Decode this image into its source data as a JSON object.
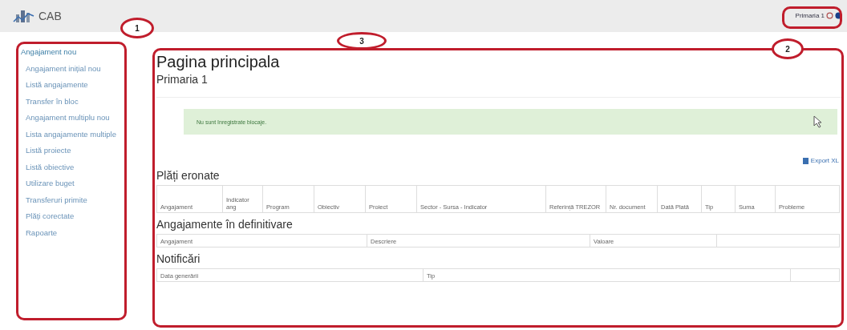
{
  "header": {
    "app_name": "CAB",
    "user": "Primaria 1"
  },
  "sidebar": {
    "items": [
      {
        "label": "Angajament nou",
        "selected": true
      },
      {
        "label": "Angajament inițial nou",
        "selected": false
      },
      {
        "label": "Listă angajamente",
        "selected": false
      },
      {
        "label": "Transfer în bloc",
        "selected": false
      },
      {
        "label": "Angajament multiplu nou",
        "selected": false
      },
      {
        "label": "Lista angajamente multiple",
        "selected": false
      },
      {
        "label": "Listă proiecte",
        "selected": false
      },
      {
        "label": "Listă obiective",
        "selected": false
      },
      {
        "label": "Utilizare buget",
        "selected": false
      },
      {
        "label": "Transferuri primite",
        "selected": false
      },
      {
        "label": "Plăți corectate",
        "selected": false
      },
      {
        "label": "Rapoarte",
        "selected": false
      }
    ]
  },
  "main": {
    "title": "Pagina principala",
    "subtitle": "Primaria 1",
    "alert": "Nu sunt înregistrate blocaje.",
    "export": "Export XL",
    "sections": [
      {
        "title": "Plăți eronate",
        "columns": [
          "Angajament",
          "Indicator ang",
          "Program",
          "Obiectiv",
          "Proiect",
          "Sector - Sursa - Indicator",
          "Referință TREZOR",
          "Nr. document",
          "Dată Plată",
          "Tip",
          "Suma",
          "Probleme"
        ]
      },
      {
        "title": "Angajamente în definitivare",
        "columns": [
          "Angajament",
          "Descriere",
          "Valoare",
          ""
        ]
      },
      {
        "title": "Notificări",
        "columns": [
          "Data generării",
          "Tip",
          ""
        ]
      }
    ]
  },
  "callouts": [
    "1",
    "3",
    "2"
  ]
}
